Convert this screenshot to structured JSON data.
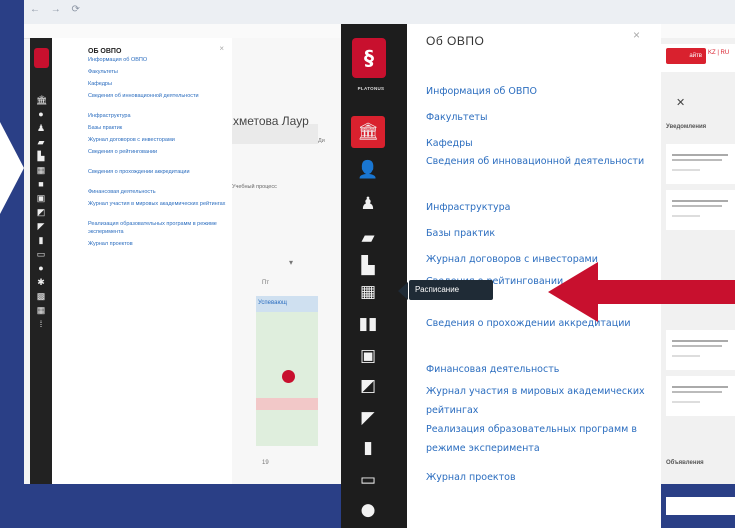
{
  "browser": {
    "nav": "← → ⟳",
    "url": "",
    "bookmarks": ""
  },
  "small_panel": {
    "title": "ОБ ОВПО",
    "close": "×",
    "links": [
      "Информация об ОВПО",
      "Факультеты",
      "Кафедры",
      "Сведения об инновационной деятельности",
      "Инфраструктура",
      "Базы практик",
      "Журнал договоров с инвесторами",
      "Сведения о рейтинговании",
      "Сведения о прохождении аккредитации",
      "Финансовая деятельность",
      "Журнал участия в мировых академических рейтингах",
      "Реализация образовательных программ в режиме эксперимента",
      "Журнал проектов"
    ]
  },
  "middle": {
    "title": "хметова Лаур",
    "subtitle": "Ди",
    "text2": "Учебный процесс",
    "row_label": "Успевающ",
    "letter": "Пт",
    "num": "19"
  },
  "right": {
    "btn_label": "айтв",
    "btn2_label": "KZ | RU",
    "header": "Уведомления",
    "footer": "Объявления"
  },
  "big_panel": {
    "logo_label": "PLATONUS",
    "title": "Об ОВПО",
    "close": "×",
    "tooltip": "Расписание",
    "links": [
      "Информация об ОВПО",
      "Факультеты",
      "Кафедры",
      "Сведения об инновационной деятельности",
      "Инфраструктура",
      "Базы практик",
      "Журнал договоров с инвесторами",
      "Сведения о рейтинговании",
      "Сведения о прохождении аккредитации",
      "Финансовая деятельность",
      "Журнал участия в мировых академических рейтингах",
      "Реализация образовательных программ в режиме эксперимента",
      "Журнал проектов"
    ]
  },
  "icons": [
    "university-icon",
    "user-icon",
    "users-icon",
    "folder-icon",
    "profile-icon",
    "calendar-grid-icon",
    "book-icon",
    "presentation-icon",
    "chat-icon",
    "edit-icon",
    "bar-chart-icon",
    "monitor-icon",
    "printer-icon"
  ],
  "colors": {
    "accent": "#c8102e",
    "background": "#2a3f86",
    "rail": "#1d1d1d",
    "link": "#2b6dbf"
  }
}
